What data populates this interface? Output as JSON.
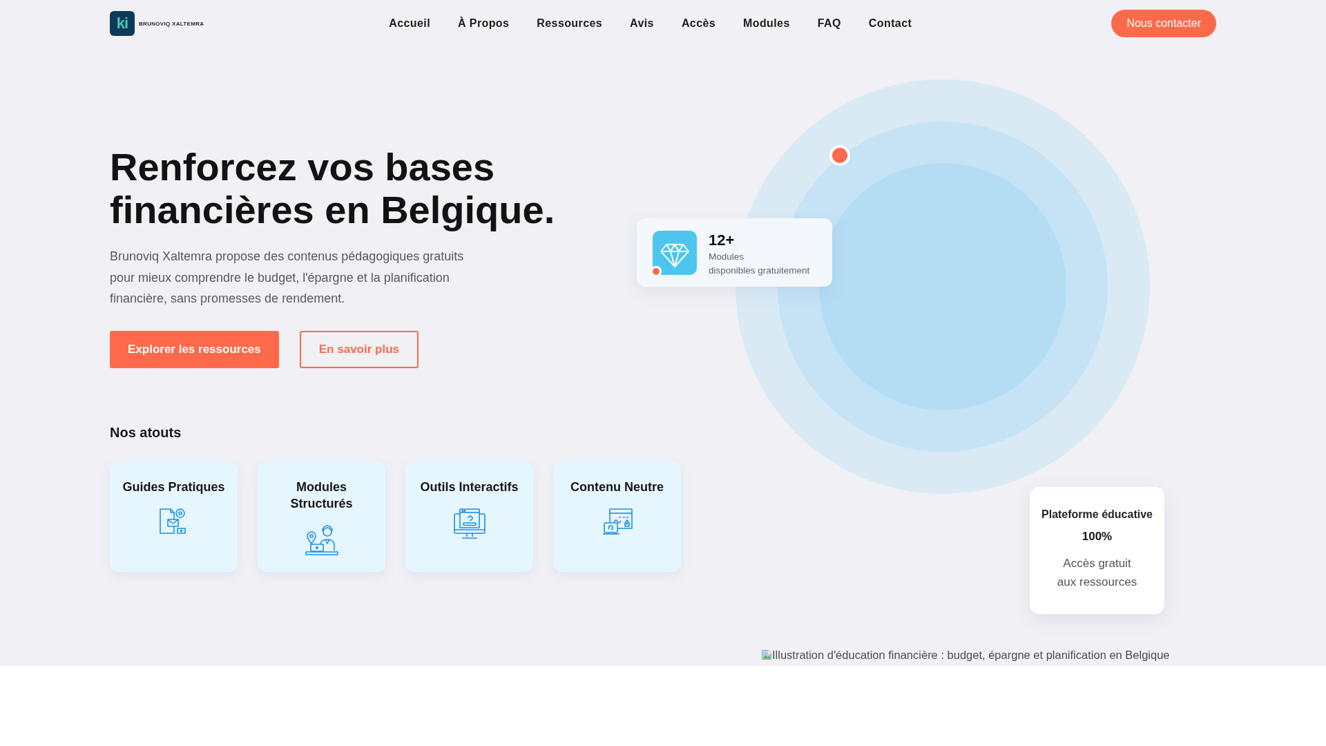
{
  "header": {
    "logo": {
      "mark": "ki",
      "name": "BRUNOVIQ XALTEMRA"
    },
    "nav": [
      "Accueil",
      "À Propos",
      "Ressources",
      "Avis",
      "Accès",
      "Modules",
      "FAQ",
      "Contact"
    ],
    "cta": "Nous contacter"
  },
  "hero": {
    "title": "Renforcez vos bases financières en Belgique.",
    "description": "Brunoviq Xaltemra propose des contenus pédagogiques gratuits pour mieux comprendre le budget, l'épargne et la planification financière, sans promesses de rendement.",
    "buttons": [
      {
        "label": "Explorer les ressources",
        "kind": "primary"
      },
      {
        "label": "En savoir plus",
        "kind": "outline"
      }
    ]
  },
  "features": {
    "heading": "Nos atouts",
    "items": [
      {
        "title": "Guides Pratiques"
      },
      {
        "title": "Modules Structurés"
      },
      {
        "title": "Outils Interactifs"
      },
      {
        "title": "Contenu Neutre"
      }
    ]
  },
  "stat_card": {
    "value": "12+",
    "label": "Modules",
    "detail": "disponibles gratuitement"
  },
  "platform_card": {
    "title": "Plateforme éducative",
    "value": "100%",
    "text": "Accès gratuit aux ressources"
  },
  "hero_image": {
    "alt": "Illustration d'éducation financière : budget, épargne et planification en Belgique"
  }
}
